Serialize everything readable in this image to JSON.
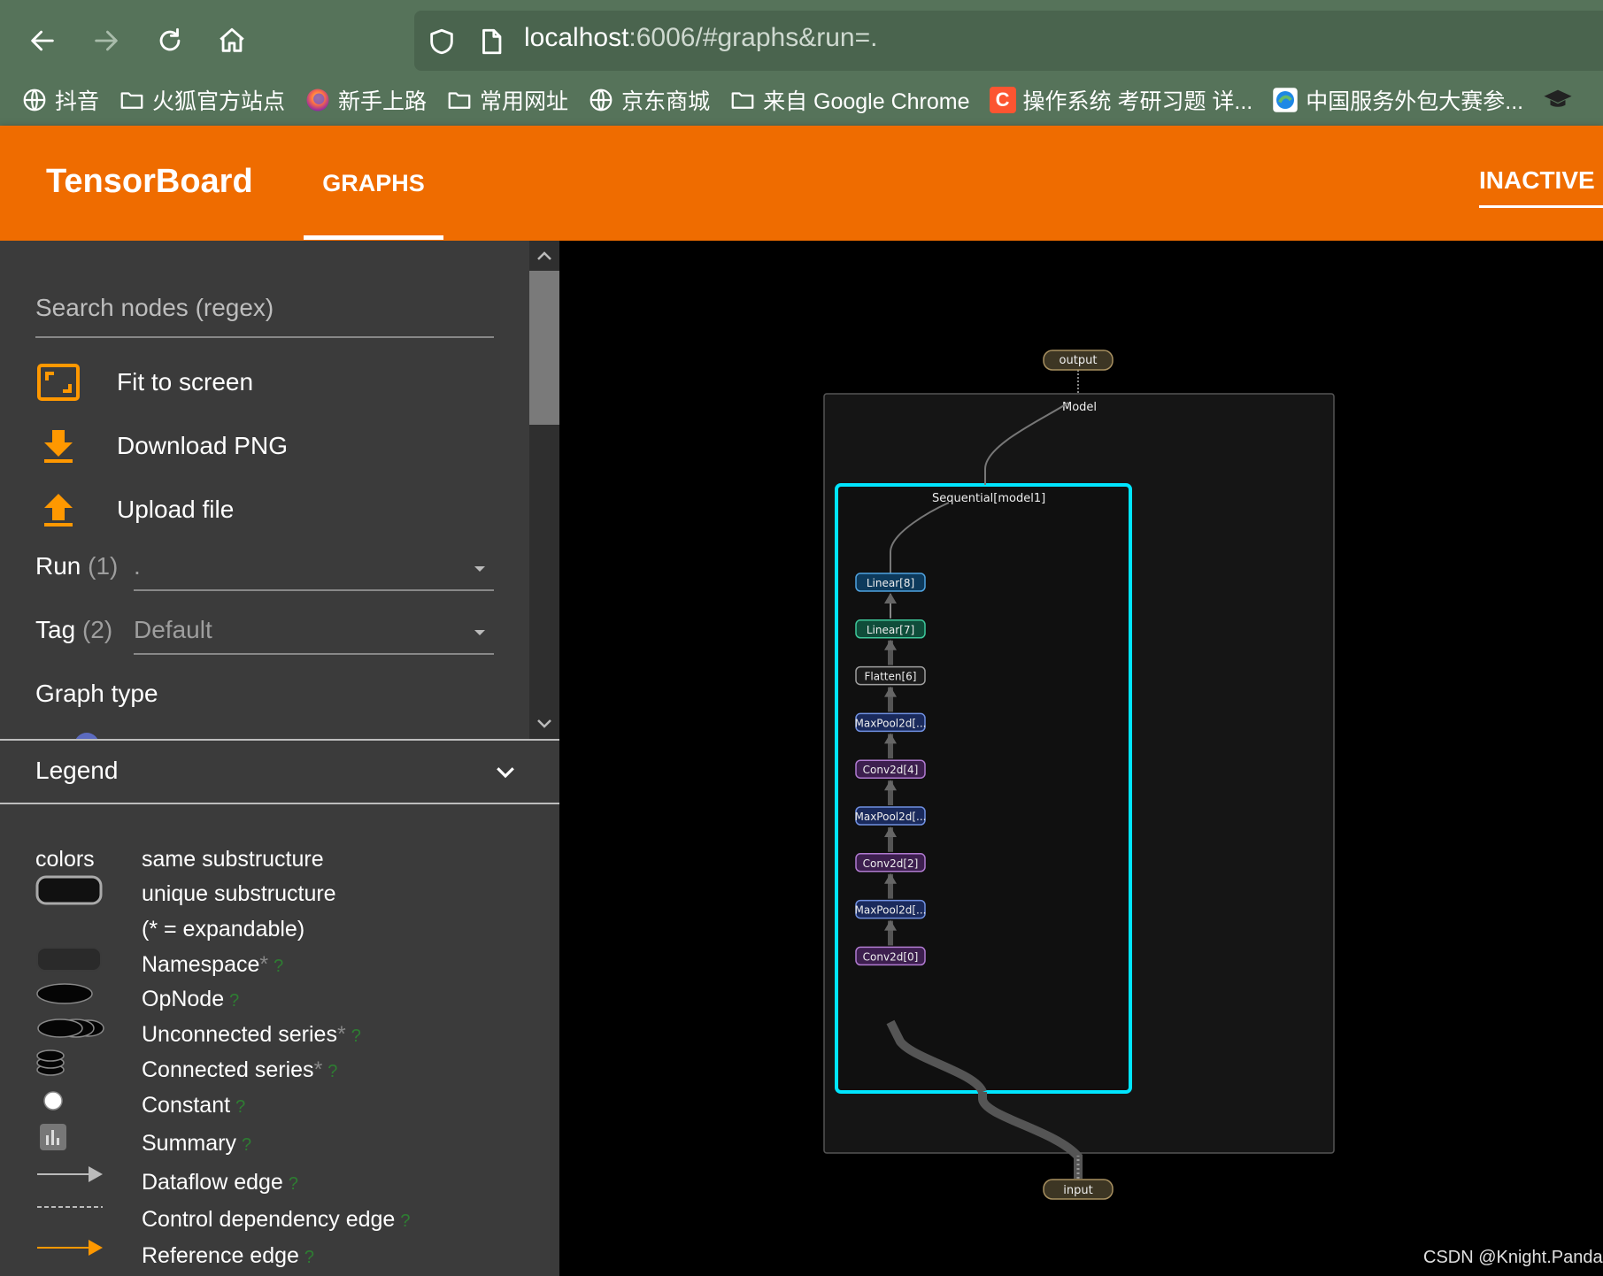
{
  "browser": {
    "url_host": "localhost",
    "url_rest": ":6006/#graphs&run=.",
    "bookmarks": [
      {
        "label": "抖音",
        "icon": "globe-icon"
      },
      {
        "label": "火狐官方站点",
        "icon": "folder-icon"
      },
      {
        "label": "新手上路",
        "icon": "firefox-icon"
      },
      {
        "label": "常用网址",
        "icon": "folder-icon"
      },
      {
        "label": "京东商城",
        "icon": "globe-icon"
      },
      {
        "label": "来自 Google Chrome",
        "icon": "folder-icon"
      },
      {
        "label": "操作系统 考研习题 详...",
        "icon": "csdn-icon",
        "color": "#fc5531"
      },
      {
        "label": "中国服务外包大赛参...",
        "icon": "site-icon",
        "color": "#1e88e5"
      }
    ]
  },
  "header": {
    "title": "TensorBoard",
    "tab": "GRAPHS",
    "status": "INACTIVE",
    "color": "#ef6c00"
  },
  "sidebar": {
    "search_placeholder": "Search nodes (regex)",
    "actions": [
      {
        "label": "Fit to screen",
        "icon": "fit-screen-icon"
      },
      {
        "label": "Download PNG",
        "icon": "download-icon"
      },
      {
        "label": "Upload file",
        "icon": "upload-icon"
      }
    ],
    "run": {
      "label": "Run",
      "count": "(1)",
      "value": "."
    },
    "tag": {
      "label": "Tag",
      "count": "(2)",
      "value": "Default"
    },
    "graph_type_label": "Graph type",
    "accent": "#ff9800"
  },
  "legend": {
    "title": "Legend",
    "colors_key": "colors",
    "colors_value": "same substructure",
    "items": [
      {
        "label": "unique substructure",
        "suffix": "",
        "help": false
      },
      {
        "label": "(* = expandable)",
        "suffix": "",
        "help": false
      },
      {
        "label": "Namespace",
        "suffix": "*",
        "help": true
      },
      {
        "label": "OpNode",
        "suffix": "",
        "help": true
      },
      {
        "label": "Unconnected series",
        "suffix": "*",
        "help": true
      },
      {
        "label": "Connected series",
        "suffix": "*",
        "help": true
      },
      {
        "label": "Constant",
        "suffix": "",
        "help": true
      },
      {
        "label": "Summary",
        "suffix": "",
        "help": true
      },
      {
        "label": "Dataflow edge",
        "suffix": "",
        "help": true
      },
      {
        "label": "Control dependency edge",
        "suffix": "",
        "help": true
      },
      {
        "label": "Reference edge",
        "suffix": "",
        "help": true
      }
    ],
    "help_mark": "?"
  },
  "graph": {
    "output_label": "output",
    "input_label": "input",
    "model_label": "Model",
    "sequential_label": "Sequential[model1]",
    "highlight_color": "#00e5ff",
    "nodes": [
      {
        "label": "Linear[8]",
        "fill": "#0d3a5c",
        "stroke": "#4fa3e0"
      },
      {
        "label": "Linear[7]",
        "fill": "#0f4d3a",
        "stroke": "#3ec79a"
      },
      {
        "label": "Flatten[6]",
        "fill": "#1b1b1b",
        "stroke": "#9e9e9e"
      },
      {
        "label": "MaxPool2d[...",
        "fill": "#1a2a5c",
        "stroke": "#6f8fe0"
      },
      {
        "label": "Conv2d[4]",
        "fill": "#3d1f4f",
        "stroke": "#b07ad0"
      },
      {
        "label": "MaxPool2d[...",
        "fill": "#1a2a5c",
        "stroke": "#6f8fe0"
      },
      {
        "label": "Conv2d[2]",
        "fill": "#3d1f4f",
        "stroke": "#b07ad0"
      },
      {
        "label": "MaxPool2d[...",
        "fill": "#1a2a5c",
        "stroke": "#6f8fe0"
      },
      {
        "label": "Conv2d[0]",
        "fill": "#3d1f4f",
        "stroke": "#b07ad0"
      }
    ]
  },
  "watermark": "CSDN @Knight.Panda"
}
